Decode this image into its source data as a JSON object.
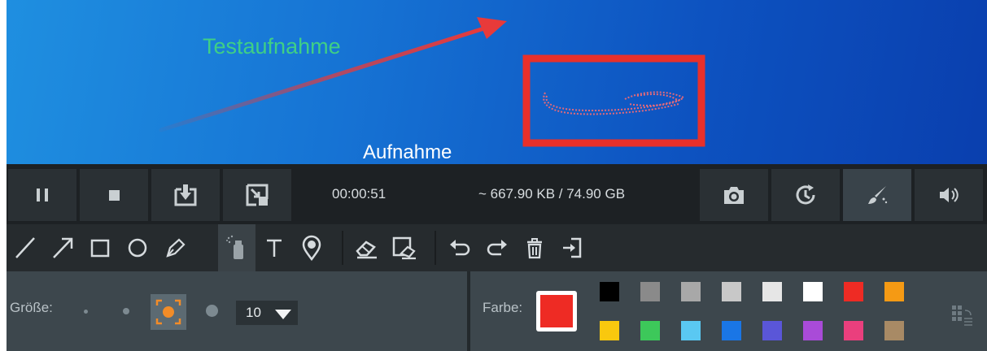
{
  "canvas": {
    "annotation_text_1": "Testaufnahme",
    "annotation_text_2": "Aufnahme",
    "arrow_color": "#e83a3a",
    "rectangle_color": "#e8302a"
  },
  "control_bar": {
    "buttons": [
      {
        "name": "pause-icon"
      },
      {
        "name": "stop-icon"
      },
      {
        "name": "download-icon"
      },
      {
        "name": "minimize-icon"
      }
    ],
    "elapsed_time": "00:00:51",
    "file_size": "~ 667.90 KB / 74.90 GB",
    "right_buttons": [
      {
        "name": "camera-icon"
      },
      {
        "name": "schedule-icon"
      },
      {
        "name": "brush-icon",
        "active": true
      },
      {
        "name": "speaker-icon"
      }
    ]
  },
  "tools": [
    "line-icon",
    "arrow-icon",
    "rectangle-icon",
    "ellipse-icon",
    "pen-icon",
    "spray-icon",
    "text-icon",
    "numbered-marker-icon",
    "eraser-icon",
    "area-eraser-icon",
    "undo-icon",
    "redo-icon",
    "delete-icon",
    "exit-icon"
  ],
  "active_tool": "spray-icon",
  "options": {
    "size_label": "Größe:",
    "size_value": "10",
    "color_label": "Farbe:",
    "current_color": "#ee2b24",
    "palette_row_1": [
      "#000000",
      "#8a8a8a",
      "#a8a8a8",
      "#c8c8c8",
      "#e6e6e6",
      "#ffffff",
      "#ee2b24",
      "#f59a14"
    ],
    "palette_row_2": [
      "#f9c80e",
      "#3dc85a",
      "#5ac8f2",
      "#1a76e6",
      "#5a56d8",
      "#a94bd8",
      "#ea3f7d",
      "#a88a65"
    ]
  }
}
